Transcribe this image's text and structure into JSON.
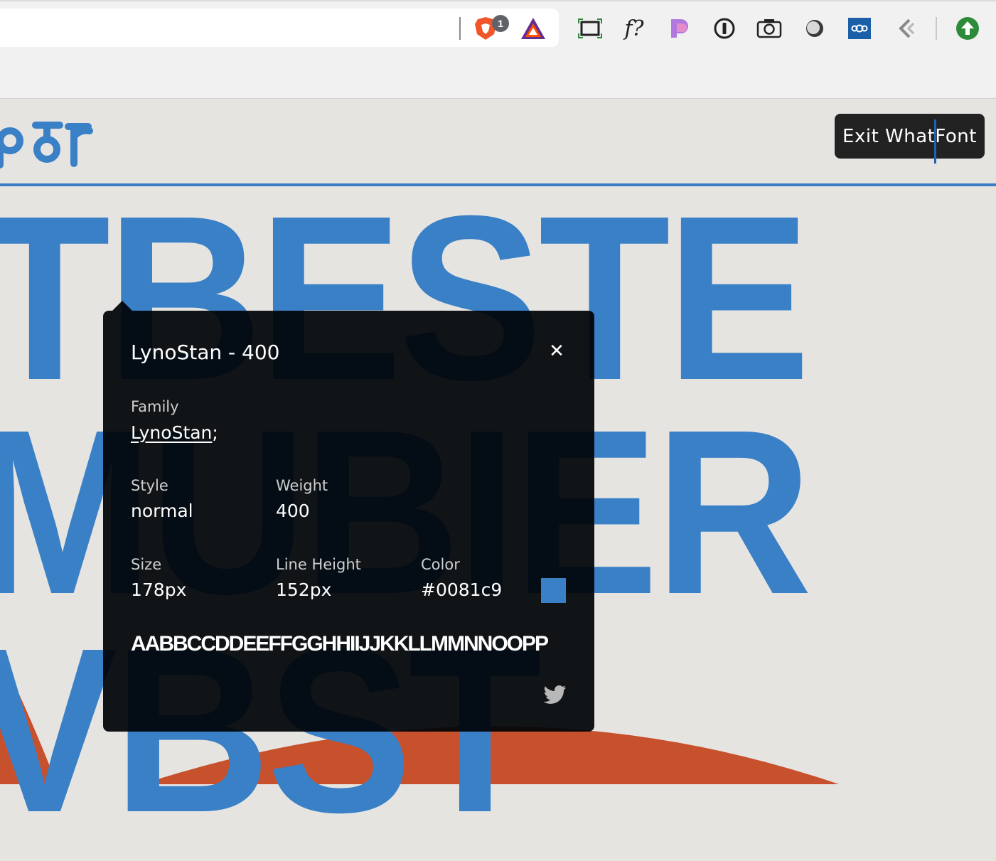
{
  "browser": {
    "brave_badge": "1",
    "toolbar": {
      "fquery_label": "f?",
      "extensions": [
        "screenshot-capture-icon",
        "whatfont-icon",
        "notion-icon",
        "onepassword-icon",
        "camera-icon",
        "theme-icon",
        "nextcloud-icon",
        "back-arrow-icon",
        "upload-arrow-icon"
      ]
    }
  },
  "page": {
    "headline": {
      "line1": "TBESTE",
      "line2": "MUBIER",
      "line3": "VBST"
    },
    "accent_color": "#3a80c6",
    "orange_color": "#c7502d"
  },
  "whatfont": {
    "exit_label": "Exit WhatFont",
    "title": "LynoStan - 400",
    "close_glyph": "✕",
    "family_label": "Family",
    "family_value": "LynoStan",
    "family_suffix": ";",
    "style_label": "Style",
    "style_value": "normal",
    "weight_label": "Weight",
    "weight_value": "400",
    "size_label": "Size",
    "size_value": "178px",
    "lineheight_label": "Line Height",
    "lineheight_value": "152px",
    "color_label": "Color",
    "color_value": "#0081c9",
    "swatch_color": "#3a80c6",
    "sample_text": "AABBCCDDEEFFGGHHIIJJKKLLMMNNOOPP"
  }
}
